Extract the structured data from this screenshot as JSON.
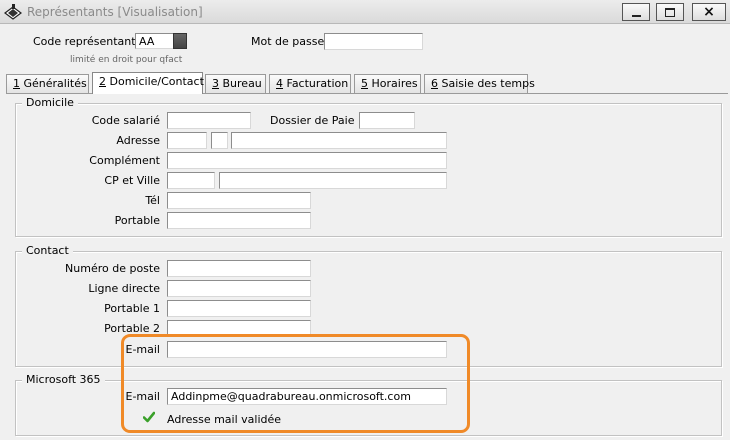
{
  "window": {
    "title": "Représentants [Visualisation]",
    "icon": "app-icon",
    "buttons": {
      "minimize": "minimize-icon",
      "maximize": "maximize-icon",
      "close": "×"
    }
  },
  "header": {
    "code_label": "Code représentant :",
    "code_value": "AA",
    "password_label": "Mot de passe",
    "password_value": "",
    "hint": "limité en droit pour qfact"
  },
  "tabs": [
    {
      "key": "1",
      "label": " Généralités",
      "active": false
    },
    {
      "key": "2",
      "label": " Domicile/Contact",
      "active": true
    },
    {
      "key": "3",
      "label": " Bureau",
      "active": false
    },
    {
      "key": "4",
      "label": " Facturation",
      "active": false
    },
    {
      "key": "5",
      "label": " Horaires",
      "active": false
    },
    {
      "key": "6",
      "label": " Saisie des temps",
      "active": false
    }
  ],
  "domicile": {
    "title": "Domicile",
    "code_salarie_label": "Code salarié",
    "code_salarie_value": "",
    "dossier_paie_label": "Dossier de Paie",
    "dossier_paie_value": "",
    "adresse_label": "Adresse",
    "adresse_values": [
      "",
      "",
      ""
    ],
    "complement_label": "Complément",
    "complement_value": "",
    "cp_ville_label": "CP et Ville",
    "cp_value": "",
    "ville_value": "",
    "tel_label": "Tél",
    "tel_value": "",
    "portable_label": "Portable",
    "portable_value": ""
  },
  "contact": {
    "title": "Contact",
    "numero_poste_label": "Numéro de poste",
    "numero_poste_value": "",
    "ligne_directe_label": "Ligne directe",
    "ligne_directe_value": "",
    "portable1_label": "Portable 1",
    "portable1_value": "",
    "portable2_label": "Portable 2",
    "portable2_value": "",
    "email_label": "E-mail",
    "email_value": ""
  },
  "microsoft365": {
    "title": "Microsoft 365",
    "email_label": "E-mail",
    "email_value": "Addinpme@quadrabureau.onmicrosoft.com",
    "validated_text": "Adresse mail validée",
    "validated_icon": "check-icon",
    "validated_color": "#3aa02a"
  },
  "colors": {
    "highlight": "#f08a28"
  }
}
